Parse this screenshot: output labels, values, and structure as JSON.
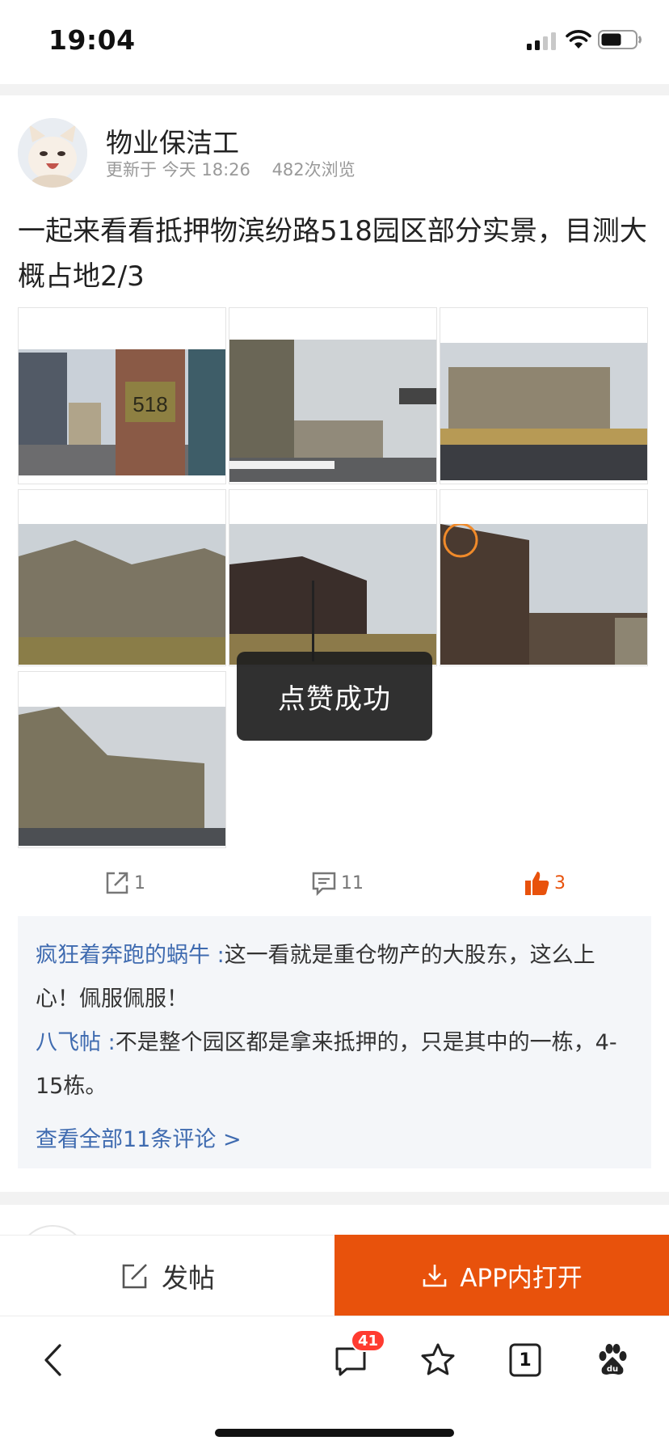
{
  "status_bar": {
    "time": "19:04"
  },
  "post": {
    "author": "物业保洁工",
    "meta": "更新于 今天 18:26    482次浏览",
    "text": "一起来看看抵押物滨纷路518园区部分实景，目测大概占地2/3",
    "plaque_text": "518",
    "actions": {
      "share_count": "1",
      "comment_count": "11",
      "like_count": "3"
    }
  },
  "comments": {
    "items": [
      {
        "author": "疯狂着奔跑的蜗牛 :",
        "text": "这一看就是重仓物产的大股东，这么上心！佩服佩服！"
      },
      {
        "author": "八飞帖 :",
        "text": "不是整个园区都是拿来抵押的，只是其中的一栋，4-15栋。"
      }
    ],
    "view_all": "查看全部11条评论 >"
  },
  "toast": "点赞成功",
  "bottom_bar": {
    "post_label": "发帖",
    "open_app_label": "APP内打开"
  },
  "browser_toolbar": {
    "message_badge": "41",
    "tab_count": "1"
  },
  "colors": {
    "accent": "#e8520c",
    "link": "#3f6bb0",
    "badge": "#ff3b30"
  },
  "icons": [
    "signal-icon",
    "wifi-icon",
    "battery-icon",
    "share-icon",
    "comment-icon",
    "thumbs-up-icon",
    "edit-icon",
    "download-icon",
    "back-icon",
    "message-icon",
    "star-icon",
    "tabs-icon",
    "baidu-paw-icon"
  ]
}
